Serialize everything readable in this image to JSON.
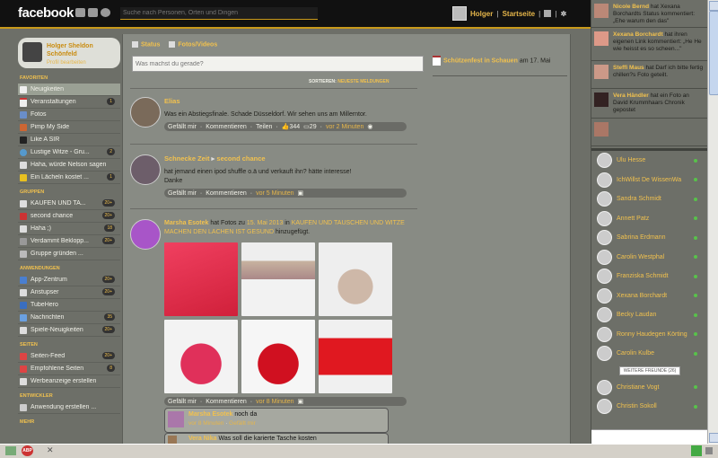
{
  "topbar": {
    "logo": "facebook",
    "search_placeholder": "Suche nach Personen, Orten und Dingen",
    "user": "Holger",
    "home": "Startseite"
  },
  "profile": {
    "name_line1": "Holger Sheldon",
    "name_line2": "Schönfeld",
    "edit": "Profil bearbeiten"
  },
  "sidebar": {
    "favorites_header": "FAVORITEN",
    "favorites": [
      {
        "label": "Neuigkeiten",
        "badge": ""
      },
      {
        "label": "Veranstaltungen",
        "badge": "1"
      },
      {
        "label": "Fotos",
        "badge": ""
      },
      {
        "label": "Pimp My Side",
        "badge": ""
      },
      {
        "label": "Like A SIR",
        "badge": ""
      },
      {
        "label": "Lustige Witze - Gru...",
        "badge": "2"
      },
      {
        "label": "Haha, würde Nelson sagen",
        "badge": ""
      },
      {
        "label": "Ein Lächeln kostet ...",
        "badge": "1"
      }
    ],
    "groups_header": "GRUPPEN",
    "groups": [
      {
        "label": "KAUFEN UND TA...",
        "badge": "20+"
      },
      {
        "label": "second chance",
        "badge": "20+"
      },
      {
        "label": "Haha ;)",
        "badge": "18"
      },
      {
        "label": "Verdammt Beklopp...",
        "badge": "20+"
      },
      {
        "label": "Gruppe gründen ...",
        "badge": ""
      }
    ],
    "apps_header": "ANWENDUNGEN",
    "apps": [
      {
        "label": "App-Zentrum",
        "badge": "20+"
      },
      {
        "label": "Anstupser",
        "badge": "20+"
      },
      {
        "label": "TubeHero",
        "badge": ""
      },
      {
        "label": "Nachrichten",
        "badge": "35"
      },
      {
        "label": "Spiele-Neuigkeiten",
        "badge": "20+"
      }
    ],
    "pages_header": "SEITEN",
    "pages": [
      {
        "label": "Seiten-Feed",
        "badge": "20+"
      },
      {
        "label": "Empfohlene Seiten",
        "badge": "8"
      },
      {
        "label": "Werbeanzeige erstellen",
        "badge": ""
      }
    ],
    "dev_header": "ENTWICKLER",
    "dev": [
      {
        "label": "Anwendung erstellen ...",
        "badge": ""
      }
    ],
    "more_header": "MEHR"
  },
  "composer": {
    "tab_status": "Status",
    "tab_photos": "Fotos/Videos",
    "placeholder": "Was machst du gerade?"
  },
  "sort": {
    "label": "SORTIEREN:",
    "value": "NEUESTE MELDUNGEN"
  },
  "posts": [
    {
      "name": "Elias",
      "text": "Was ein Abstiegsfinale. Schade Düsseldorf. Wir sehen uns am Millerntor.",
      "like": "Gefällt mir",
      "comment": "Kommentieren",
      "share": "Teilen",
      "likes": "344",
      "comments": "29",
      "time": "vor 2 Minuten"
    },
    {
      "name": "Schnecke Zeit",
      "arrow": "▸",
      "target": "second chance",
      "text_line1": "hat jemand einen ipod shuffle o.ä und verkauft ihn? hätte interesse!",
      "text_line2": "Danke",
      "like": "Gefällt mir",
      "comment": "Kommentieren",
      "time": "vor 5 Minuten"
    },
    {
      "name": "Marsha Esotek",
      "text_pre": "hat Fotos zu",
      "album": "15. Mai 2013",
      "text_mid": "in",
      "group": "KAUFEN UND TAUSCHEN UND WITZE MACHEN DEN LACHEN IST GESUND",
      "text_post": "hinzugefügt.",
      "like": "Gefällt mir",
      "comment": "Kommentieren",
      "time": "vor 8 Minuten"
    }
  ],
  "comments": [
    {
      "name": "Marsha Esotek",
      "text": "noch da",
      "time": "vor 8 Minuten",
      "like": "Gefällt mir"
    },
    {
      "name": "Vera Nika",
      "text": "Was soll die karierte Tasche kosten"
    }
  ],
  "event": {
    "title": "Schützenfest in Schauen",
    "date_pre": "am",
    "date": "17. Mai"
  },
  "ticker": [
    {
      "name": "Nicole Bernd",
      "text": "hat Xexana Borchardts Status kommentiert: „Ehe warum den das\""
    },
    {
      "name": "Xexana Borchardt",
      "text": "hat ihren eigenen Link kommentiert: „He He wie heisst es so scheen...\""
    },
    {
      "name": "Steffi Maus",
      "text": "hat Darf ich bitte fertig chillen?s Foto geteilt."
    },
    {
      "name": "Vera Händler",
      "text": "hat ein Foto an David Krummhaars Chronik gepostet"
    },
    {
      "name": "",
      "text": ""
    }
  ],
  "friends": [
    "Ulu Hesse",
    "IchWillst De WissenWa",
    "Sandra Schmidt",
    "Annett Patz",
    "Sabrina Erdmann",
    "Carolin Westphal",
    "Franziska Schmidt",
    "Xexana Borchardt",
    "Becky Laudan",
    "Ronny Haudegen Körting",
    "Carolin Kulbe"
  ],
  "more_friends_label": "WEITERE FREUNDE (26)",
  "friends_more": [
    "Christiane Vogt",
    "Christin Sokoll"
  ],
  "taskbar": {
    "abp": "ABP",
    "close": "✕"
  }
}
